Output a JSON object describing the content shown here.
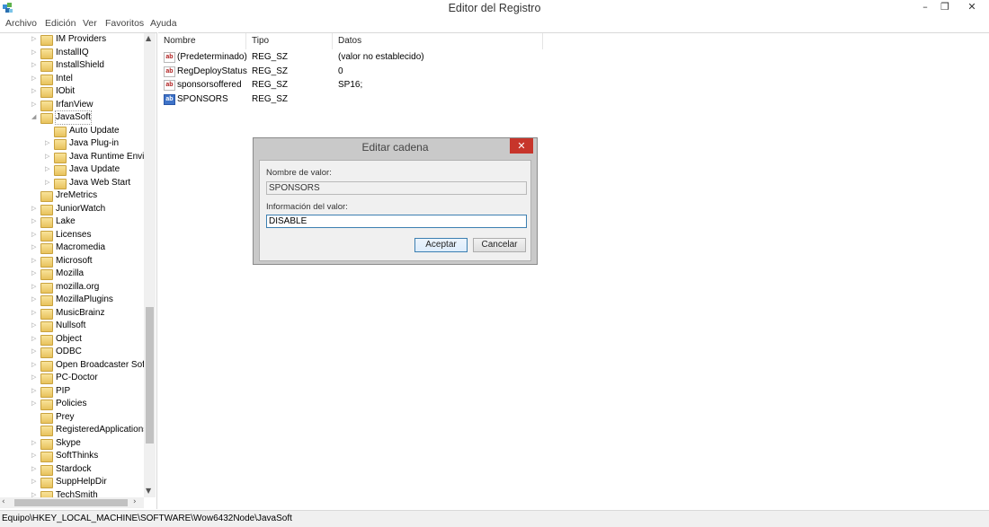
{
  "window": {
    "title": "Editor del Registro"
  },
  "menu": [
    "Archivo",
    "Edición",
    "Ver",
    "Favoritos",
    "Ayuda"
  ],
  "tree": {
    "items": [
      {
        "label": "IM Providers",
        "level": 0,
        "expander": "▷"
      },
      {
        "label": "InstallIQ",
        "level": 0,
        "expander": "▷"
      },
      {
        "label": "InstallShield",
        "level": 0,
        "expander": "▷"
      },
      {
        "label": "Intel",
        "level": 0,
        "expander": "▷"
      },
      {
        "label": "IObit",
        "level": 0,
        "expander": "▷"
      },
      {
        "label": "IrfanView",
        "level": 0,
        "expander": "▷"
      },
      {
        "label": "JavaSoft",
        "level": 0,
        "expander": "◢",
        "selected": true
      },
      {
        "label": "Auto Update",
        "level": 1,
        "expander": ""
      },
      {
        "label": "Java Plug-in",
        "level": 1,
        "expander": "▷"
      },
      {
        "label": "Java Runtime Enviro",
        "level": 1,
        "expander": "▷"
      },
      {
        "label": "Java Update",
        "level": 1,
        "expander": "▷"
      },
      {
        "label": "Java Web Start",
        "level": 1,
        "expander": "▷"
      },
      {
        "label": "JreMetrics",
        "level": 0,
        "expander": ""
      },
      {
        "label": "JuniorWatch",
        "level": 0,
        "expander": "▷"
      },
      {
        "label": "Lake",
        "level": 0,
        "expander": "▷"
      },
      {
        "label": "Licenses",
        "level": 0,
        "expander": "▷"
      },
      {
        "label": "Macromedia",
        "level": 0,
        "expander": "▷"
      },
      {
        "label": "Microsoft",
        "level": 0,
        "expander": "▷"
      },
      {
        "label": "Mozilla",
        "level": 0,
        "expander": "▷"
      },
      {
        "label": "mozilla.org",
        "level": 0,
        "expander": "▷"
      },
      {
        "label": "MozillaPlugins",
        "level": 0,
        "expander": "▷"
      },
      {
        "label": "MusicBrainz",
        "level": 0,
        "expander": "▷"
      },
      {
        "label": "Nullsoft",
        "level": 0,
        "expander": "▷"
      },
      {
        "label": "Object",
        "level": 0,
        "expander": "▷"
      },
      {
        "label": "ODBC",
        "level": 0,
        "expander": "▷"
      },
      {
        "label": "Open Broadcaster Softw",
        "level": 0,
        "expander": "▷"
      },
      {
        "label": "PC-Doctor",
        "level": 0,
        "expander": "▷"
      },
      {
        "label": "PIP",
        "level": 0,
        "expander": "▷"
      },
      {
        "label": "Policies",
        "level": 0,
        "expander": "▷"
      },
      {
        "label": "Prey",
        "level": 0,
        "expander": ""
      },
      {
        "label": "RegisteredApplications",
        "level": 0,
        "expander": ""
      },
      {
        "label": "Skype",
        "level": 0,
        "expander": "▷"
      },
      {
        "label": "SoftThinks",
        "level": 0,
        "expander": "▷"
      },
      {
        "label": "Stardock",
        "level": 0,
        "expander": "▷"
      },
      {
        "label": "SuppHelpDir",
        "level": 0,
        "expander": "▷"
      },
      {
        "label": "TechSmith",
        "level": 0,
        "expander": "▷"
      }
    ]
  },
  "values": {
    "headers": {
      "name": "Nombre",
      "type": "Tipo",
      "data": "Datos"
    },
    "rows": [
      {
        "name": "(Predeterminado)",
        "type": "REG_SZ",
        "data": "(valor no establecido)",
        "icon": "ab-icon"
      },
      {
        "name": "RegDeployStatus",
        "type": "REG_SZ",
        "data": "0",
        "icon": "ab-icon"
      },
      {
        "name": "sponsorsoffered",
        "type": "REG_SZ",
        "data": "SP16;",
        "icon": "ab-icon"
      },
      {
        "name": "SPONSORS",
        "type": "REG_SZ",
        "data": "",
        "icon": "ab-icon-selected",
        "selected": true
      }
    ]
  },
  "dialog": {
    "title": "Editar cadena",
    "name_label": "Nombre de valor:",
    "name_value": "SPONSORS",
    "data_label": "Información del valor:",
    "data_value": "DISABLE",
    "ok_label": "Aceptar",
    "cancel_label": "Cancelar"
  },
  "statusbar": {
    "path": "Equipo\\HKEY_LOCAL_MACHINE\\SOFTWARE\\Wow6432Node\\JavaSoft"
  }
}
